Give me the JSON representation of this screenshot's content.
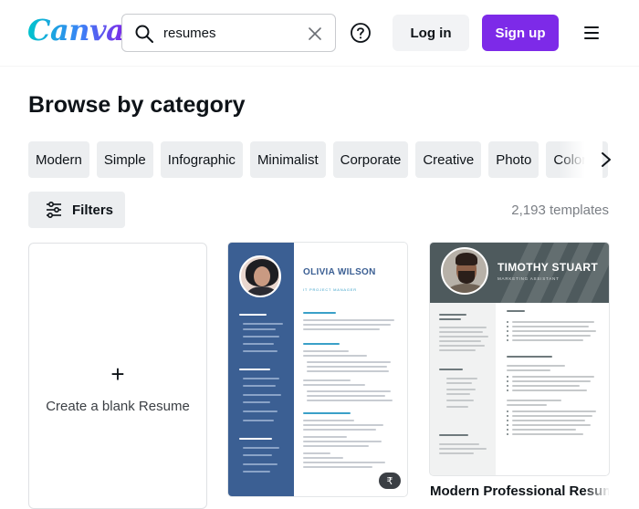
{
  "header": {
    "logo_text": "Canva",
    "search": {
      "value": "resumes",
      "icon": "search-icon",
      "clear_icon": "close-icon"
    },
    "help_icon": "help-circle-icon",
    "login_label": "Log in",
    "signup_label": "Sign up",
    "menu_icon": "hamburger-menu-icon"
  },
  "browse": {
    "title": "Browse by category",
    "categories": [
      "Modern",
      "Simple",
      "Infographic",
      "Minimalist",
      "Corporate",
      "Creative",
      "Photo",
      "Colorful"
    ],
    "next_icon": "chevron-right-icon"
  },
  "toolbar": {
    "filters_label": "Filters",
    "filters_icon": "sliders-icon",
    "template_count": "2,193 templates"
  },
  "templates": {
    "blank": {
      "plus": "+",
      "label": "Create a blank Resume"
    },
    "card1": {
      "name": "OLIVIA WILSON",
      "role": "IT PROJECT MANAGER",
      "badge": "₹",
      "badge_icon": "premium-coin-icon"
    },
    "card2": {
      "name": "TIMOTHY STUART",
      "role": "MARKETING ASSISTANT",
      "title": "Modern Professional Resume"
    }
  },
  "colors": {
    "brand_purple": "#7d2ae8",
    "resume_blue": "#3b5f93",
    "resume_gray": "#4e5a5d"
  }
}
